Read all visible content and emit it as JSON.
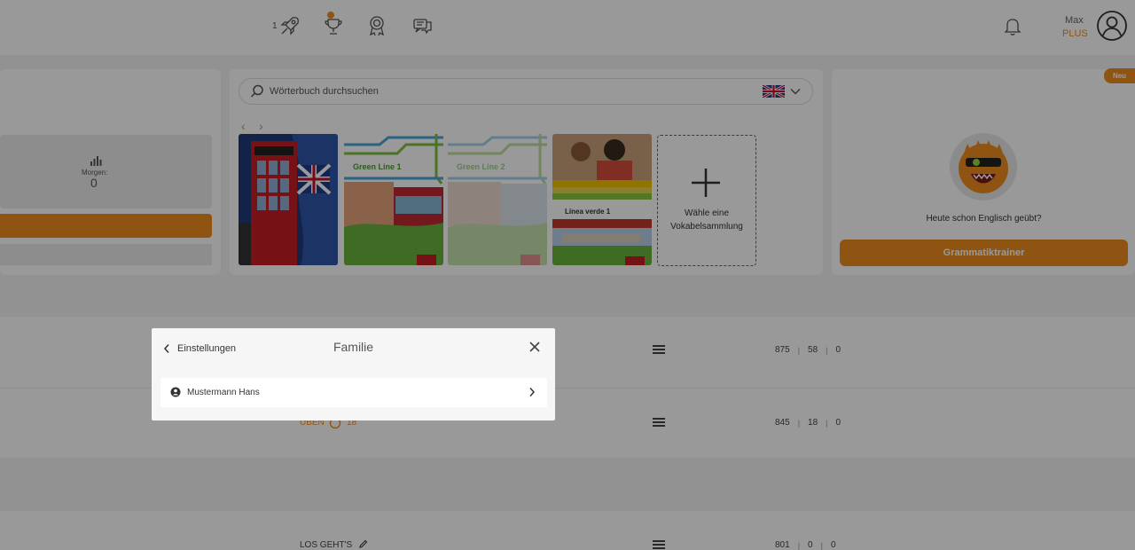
{
  "topbar": {
    "rocket_count": "1",
    "icons": [
      "rocket-icon",
      "trophy-icon",
      "badge-icon",
      "chat-icon",
      "bell-icon",
      "user-circle-icon"
    ],
    "user_name": "Max",
    "user_plan": "PLUS"
  },
  "left_panel": {
    "stat_label": "Morgen:",
    "stat_value": "0"
  },
  "dictionary": {
    "search_placeholder": "Wörterbuch durchsuchen",
    "language": "English"
  },
  "books": [
    {
      "cover_text": ""
    },
    {
      "cover_text": "Green Line 1"
    },
    {
      "cover_text": "Green Line 2"
    },
    {
      "cover_text": "Línea verde 1"
    }
  ],
  "add_collection": {
    "label": "Wähle eine Vokabelsammlung"
  },
  "grammar": {
    "badge": "Neu",
    "prompt": "Heute schon Englisch geübt?",
    "button_label": "Grammatiktrainer"
  },
  "rows": [
    {
      "action": "",
      "stats": [
        "875",
        "58",
        "0"
      ]
    },
    {
      "action": "ÜBEN",
      "count": "18",
      "stats": [
        "845",
        "18",
        "0"
      ]
    },
    {
      "action": "LOS GEHT'S",
      "stats": [
        "801",
        "0",
        "0"
      ]
    }
  ],
  "modal": {
    "back_label": "Einstellungen",
    "title": "Familie",
    "members": [
      {
        "name": "Mustermann Hans"
      }
    ]
  },
  "colors": {
    "accent": "#f08c1e",
    "overlay": "rgba(0,0,0,0.4)"
  }
}
